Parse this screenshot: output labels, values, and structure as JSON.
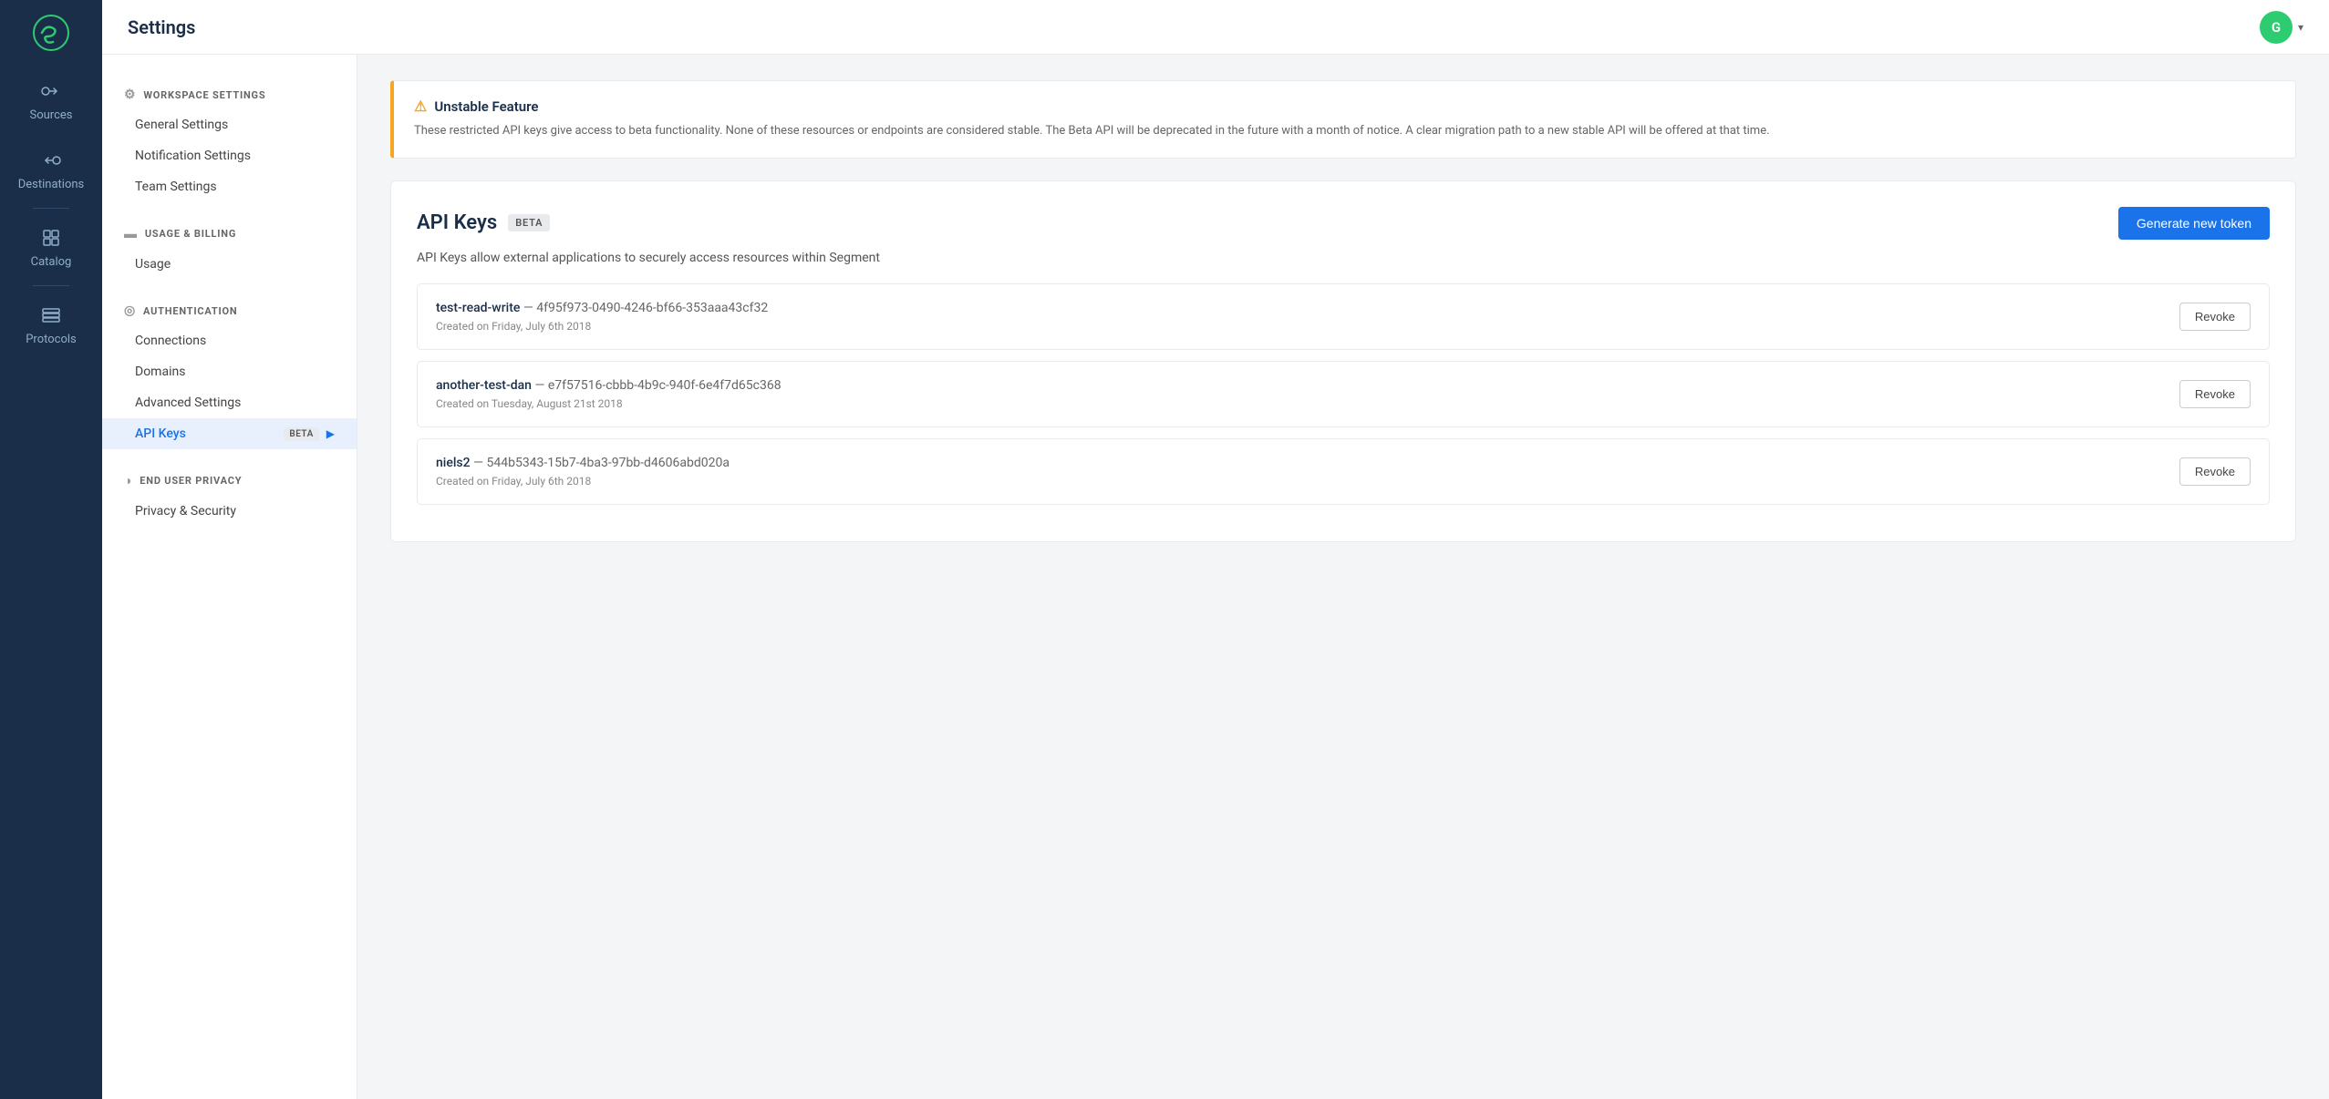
{
  "header": {
    "title": "Settings",
    "user_initial": "G"
  },
  "left_nav": {
    "items": [
      {
        "label": "Sources",
        "icon": "sources"
      },
      {
        "label": "Destinations",
        "icon": "destinations"
      },
      {
        "label": "Catalog",
        "icon": "catalog"
      },
      {
        "label": "Protocols",
        "icon": "protocols"
      }
    ]
  },
  "sidebar": {
    "sections": [
      {
        "id": "workspace",
        "header": "WORKSPACE SETTINGS",
        "items": [
          {
            "label": "General Settings",
            "active": false
          },
          {
            "label": "Notification Settings",
            "active": false
          },
          {
            "label": "Team Settings",
            "active": false
          }
        ]
      },
      {
        "id": "billing",
        "header": "USAGE & BILLING",
        "items": [
          {
            "label": "Usage",
            "active": false
          }
        ]
      },
      {
        "id": "auth",
        "header": "AUTHENTICATION",
        "items": [
          {
            "label": "Connections",
            "active": false
          },
          {
            "label": "Domains",
            "active": false
          },
          {
            "label": "Advanced Settings",
            "active": false
          },
          {
            "label": "API Keys",
            "badge": "BETA",
            "active": true
          }
        ]
      },
      {
        "id": "privacy",
        "header": "END USER PRIVACY",
        "items": [
          {
            "label": "Privacy & Security",
            "active": false
          }
        ]
      }
    ]
  },
  "warning": {
    "title": "Unstable Feature",
    "text": "These restricted API keys give access to beta functionality. None of these resources or endpoints are considered stable. The Beta API will be deprecated in the future with a month of notice. A clear migration path to a new stable API will be offered at that time."
  },
  "api_keys": {
    "title": "API Keys",
    "badge": "BETA",
    "generate_btn": "Generate new token",
    "description": "API Keys allow external applications to securely access resources within Segment",
    "keys": [
      {
        "name": "test-read-write",
        "id": "4f95f973-0490-4246-bf66-353aaa43cf32",
        "created": "Created on Friday, July 6th 2018",
        "revoke_label": "Revoke"
      },
      {
        "name": "another-test-dan",
        "id": "e7f57516-cbbb-4b9c-940f-6e4f7d65c368",
        "created": "Created on Tuesday, August 21st 2018",
        "revoke_label": "Revoke"
      },
      {
        "name": "niels2",
        "id": "544b5343-15b7-4ba3-97bb-d4606abd020a",
        "created": "Created on Friday, July 6th 2018",
        "revoke_label": "Revoke"
      }
    ]
  }
}
